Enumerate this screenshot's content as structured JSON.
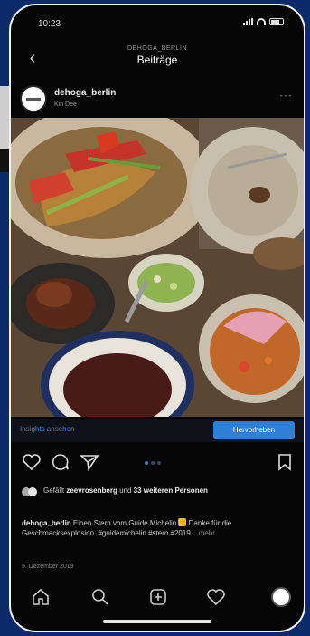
{
  "status": {
    "time": "10:23"
  },
  "nav": {
    "back_icon": "chevron-left-icon",
    "account": "DEHOGA_BERLIN",
    "title": "Beiträge"
  },
  "post": {
    "username": "dehoga_berlin",
    "location": "Kin Dee",
    "more_icon": "ellipsis-icon"
  },
  "insights": {
    "link": "Insights ansehen",
    "button": "Hervorheben"
  },
  "likes": {
    "prefix": "Gefällt",
    "user": "zeevrosenberg",
    "middle": "und",
    "others": "33 weiteren Personen"
  },
  "caption": {
    "username": "dehoga_berlin",
    "text1": "Einen Stern vom Guide Michelin",
    "text2": "Danke für die Geschmacksexplosion. #guidemichelin #stern #2019...",
    "more": "mehr"
  },
  "date": "5. Dezember 2019",
  "colors": {
    "accent": "#2f7fd6",
    "link": "#3a82c8",
    "background": "#0d2a6a"
  }
}
